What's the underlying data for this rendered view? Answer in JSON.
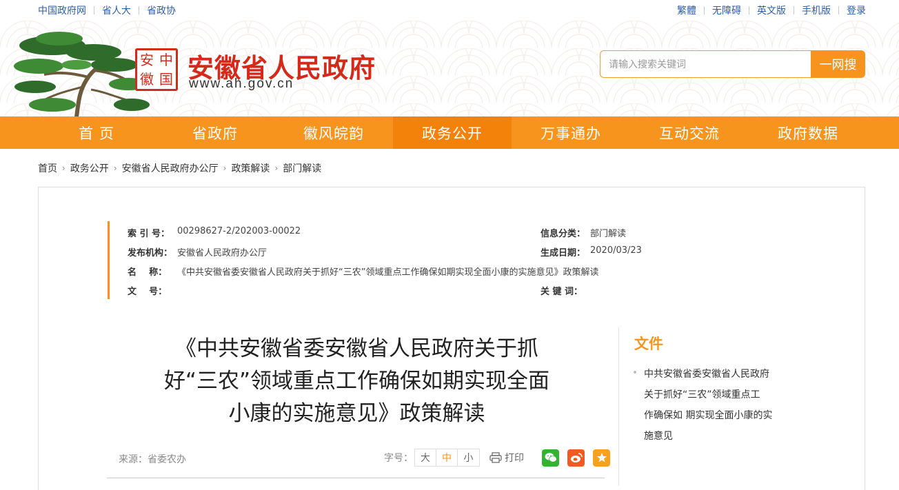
{
  "topbar": {
    "left_links": [
      "中国政府网",
      "省人大",
      "省政协"
    ],
    "right_links": [
      "繁體",
      "无障碍",
      "英文版",
      "手机版",
      "登录"
    ]
  },
  "header": {
    "seal_chars": [
      "安",
      "中",
      "徽",
      "国"
    ],
    "site_title": "安徽省人民政府",
    "site_url": "www.ah.gov.cn",
    "search_placeholder": "请输入搜索关键词",
    "search_button": "一网搜"
  },
  "nav": {
    "items": [
      "首 页",
      "省政府",
      "徽风皖韵",
      "政务公开",
      "万事通办",
      "互动交流",
      "政府数据"
    ],
    "active_index": 3
  },
  "breadcrumb": [
    "首页",
    "政务公开",
    "安徽省人民政府办公厅",
    "政策解读",
    "部门解读"
  ],
  "meta": {
    "index_label": "索 引 号：",
    "index_value": "00298627-2/202003-00022",
    "category_label": "信息分类：",
    "category_value": "部门解读",
    "publisher_label": "发布机构：",
    "publisher_value": "安徽省人民政府办公厅",
    "date_label": "生成日期：",
    "date_value": "2020/03/23",
    "name_label": "名    称：",
    "name_value": "《中共安徽省委安徽省人民政府关于抓好“三农”领域重点工作确保如期实现全面小康的实施意见》政策解读",
    "docno_label": "文    号：",
    "docno_value": "",
    "keywords_label": "关 键 词：",
    "keywords_value": ""
  },
  "article": {
    "title_lines": [
      "《中共安徽省委安徽省人民政府关于抓",
      "好“三农”领域重点工作确保如期实现全面",
      "小康的实施意见》政策解读"
    ],
    "source": "来源：省委农办",
    "font_size_label": "字号：",
    "font_sizes": [
      "大",
      "中",
      "小"
    ],
    "print_label": "打印"
  },
  "sidebar": {
    "title": "文件",
    "item_lines": [
      "中共安徽省委安徽省人民政府",
      "关于抓好“三农”领域重点工",
      "作确保如 期实现全面小康的实",
      "施意见"
    ]
  },
  "colors": {
    "accent": "#f7941d",
    "brand_red": "#d42a1b",
    "link_blue": "#2f5ea8"
  }
}
